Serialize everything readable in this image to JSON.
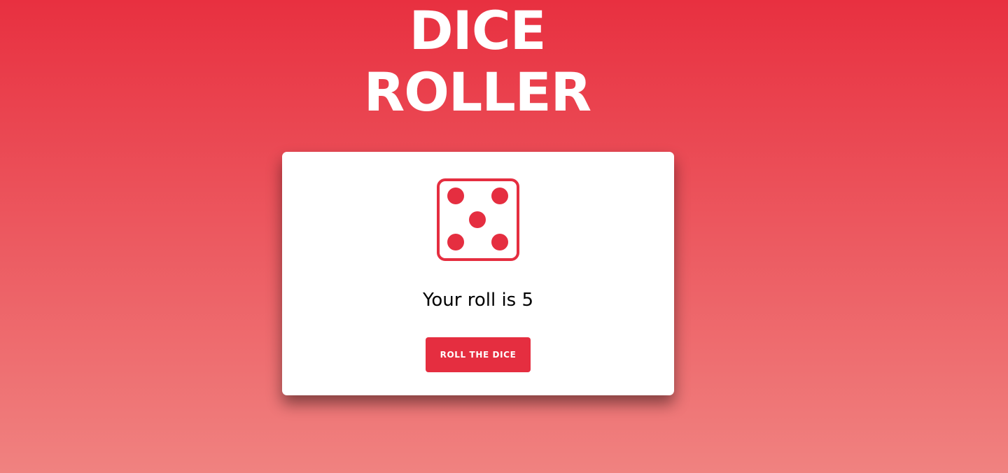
{
  "header": {
    "title_line1": "DICE",
    "title_line2": "ROLLER"
  },
  "card": {
    "die": {
      "icon": "dice-five-icon",
      "face_value": 5,
      "color": "#e52e40"
    },
    "roll_text": "Your roll is 5",
    "roll_button_label": "ROLL THE DICE"
  },
  "colors": {
    "background_top": "#e83040",
    "background_bottom": "#f08280",
    "accent": "#e52e40",
    "card": "#ffffff"
  }
}
